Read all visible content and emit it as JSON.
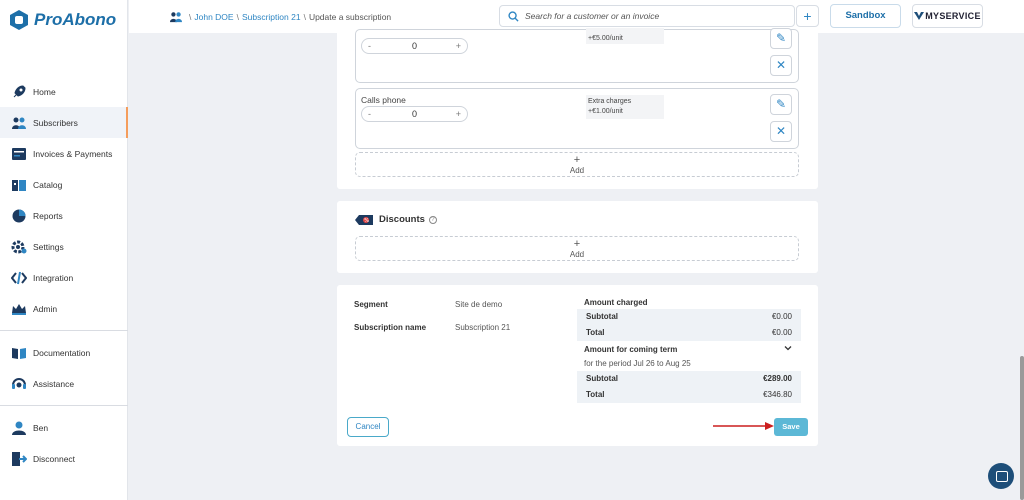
{
  "app": {
    "name": "ProAbono"
  },
  "sidebar": {
    "items": [
      {
        "label": "Home",
        "icon": "rocket-icon"
      },
      {
        "label": "Subscribers",
        "icon": "subscribers-icon",
        "active": true
      },
      {
        "label": "Invoices & Payments",
        "icon": "invoice-icon"
      },
      {
        "label": "Catalog",
        "icon": "catalog-icon"
      },
      {
        "label": "Reports",
        "icon": "pie-chart-icon"
      },
      {
        "label": "Settings",
        "icon": "gear-icon"
      },
      {
        "label": "Integration",
        "icon": "code-icon"
      },
      {
        "label": "Admin",
        "icon": "crown-icon"
      }
    ],
    "help_items": [
      {
        "label": "Documentation",
        "icon": "book-icon"
      },
      {
        "label": "Assistance",
        "icon": "headset-icon"
      }
    ],
    "user_items": [
      {
        "label": "Ben",
        "icon": "user-icon"
      },
      {
        "label": "Disconnect",
        "icon": "logout-icon"
      }
    ]
  },
  "breadcrumb": {
    "items": [
      {
        "label": "John DOE",
        "link": true
      },
      {
        "label": "Subscription 21",
        "link": true
      },
      {
        "label": "Update a subscription",
        "link": false
      }
    ],
    "separator": "\\"
  },
  "header": {
    "search_placeholder": "Search for a customer or an invoice",
    "plus_label": "+",
    "sandbox_label": "Sandbox",
    "brand_badge": "MYSERVICE"
  },
  "addons": [
    {
      "name": "",
      "quantity": "0",
      "charges_label": "Extra charges",
      "charges_value": "+€5.00/unit"
    },
    {
      "name": "Calls phone",
      "quantity": "0",
      "charges_label": "Extra charges",
      "charges_value": "+€1.00/unit"
    }
  ],
  "add_label": "Add",
  "discounts": {
    "title": "Discounts",
    "add_label": "Add"
  },
  "summary": {
    "segment_label": "Segment",
    "segment_value": "Site de demo",
    "subscription_name_label": "Subscription name",
    "subscription_name_value": "Subscription 21",
    "amount_charged_title": "Amount charged",
    "subtotal_label": "Subtotal",
    "subtotal_value": "€0.00",
    "total_label": "Total",
    "total_value": "€0.00",
    "coming_term_title": "Amount for coming term",
    "period_text": "for the period Jul 26 to Aug 25",
    "coming_subtotal_label": "Subtotal",
    "coming_subtotal_value": "€289.00",
    "coming_total_label": "Total",
    "coming_total_value": "€346.80"
  },
  "actions": {
    "cancel_label": "Cancel",
    "save_label": "Save"
  },
  "colors": {
    "accent": "#2f86c3",
    "save": "#5cb8d6",
    "active_marker": "#f59d5c",
    "arrow": "#cc1f1f"
  }
}
